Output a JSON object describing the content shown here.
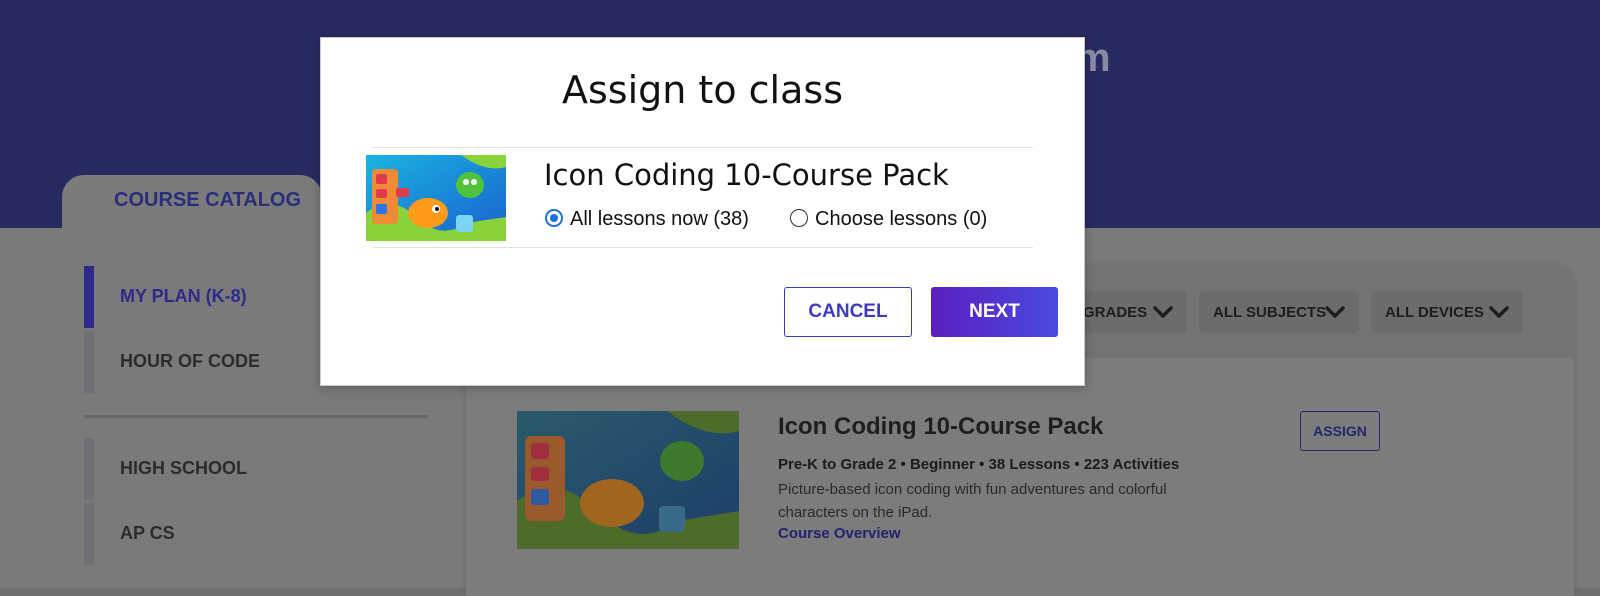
{
  "colors": {
    "accent": "#3d3bc1",
    "next_button": "#5a1fbf",
    "hero": "#2a2a63",
    "radio": "#1e6fdc"
  },
  "header": {
    "title_fragment": "m"
  },
  "tabs": {
    "course_catalog": "COURSE CATALOG"
  },
  "sidebar": {
    "items": [
      {
        "label": "MY PLAN (K-8)",
        "active": true
      },
      {
        "label": "HOUR OF CODE",
        "active": false
      },
      {
        "label": "HIGH SCHOOL",
        "active": false
      },
      {
        "label": "AP CS",
        "active": false
      }
    ]
  },
  "filters": [
    {
      "label": "GRADES",
      "icon": "chevron-down-icon"
    },
    {
      "label": "ALL SUBJECTS",
      "icon": "chevron-down-icon"
    },
    {
      "label": "ALL DEVICES",
      "icon": "chevron-down-icon"
    }
  ],
  "course_card": {
    "title": "Icon Coding 10-Course Pack",
    "meta": "Pre-K to Grade 2 • Beginner • 38 Lessons • 223 Activities",
    "description": "Picture-based icon coding with fun adventures and colorful characters on the iPad.",
    "link": "Course Overview",
    "assign_label": "ASSIGN",
    "thumbnail_icon": "course-thumbnail-illustration"
  },
  "modal": {
    "title": "Assign to class",
    "course_name": "Icon Coding 10-Course Pack",
    "options": [
      {
        "label": "All lessons now (38)",
        "selected": true
      },
      {
        "label": "Choose lessons (0)",
        "selected": false
      }
    ],
    "cancel_label": "CANCEL",
    "next_label": "NEXT"
  }
}
